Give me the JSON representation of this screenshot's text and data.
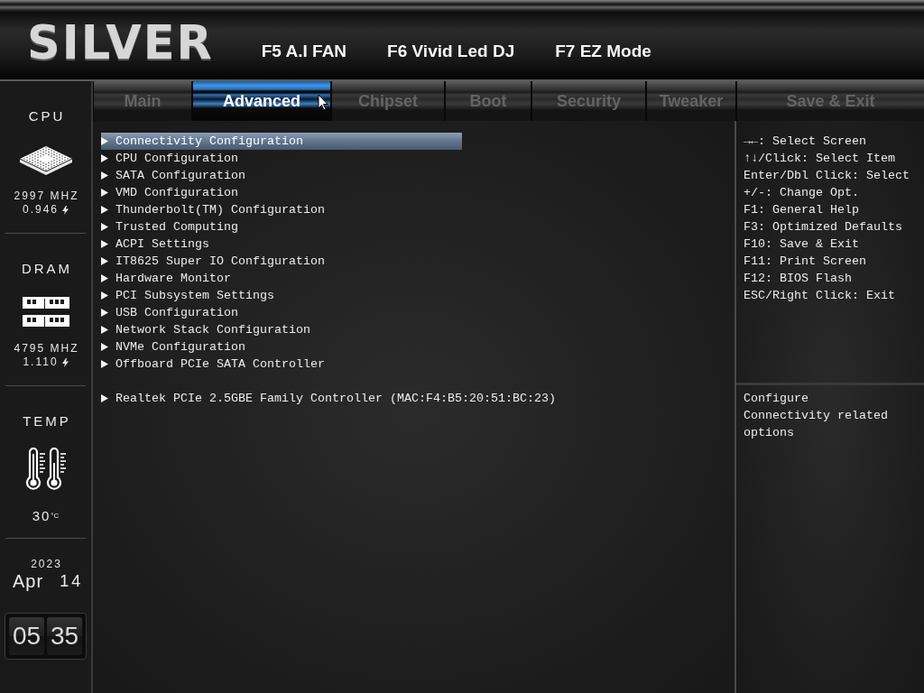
{
  "header": {
    "logo": "SILVER",
    "hotkeys": [
      "F5 A.I FAN",
      "F6 Vivid Led DJ",
      "F7 EZ Mode"
    ]
  },
  "sidebar": {
    "monitors": [
      {
        "kind": "cpu",
        "label": "CPU",
        "frequency": "2997 MHZ",
        "voltage": "0.946"
      },
      {
        "kind": "dram",
        "label": "DRAM",
        "frequency": "4795 MHZ",
        "voltage": "1.110"
      },
      {
        "kind": "temp",
        "label": "TEMP",
        "value": "30",
        "unit": "°C"
      }
    ],
    "date": {
      "year": "2023",
      "month": "Apr",
      "day": "14"
    },
    "clock": {
      "hours": "05",
      "minutes": "35"
    }
  },
  "tabs": [
    {
      "label": "Main",
      "selected": false
    },
    {
      "label": "Advanced",
      "selected": true
    },
    {
      "label": "Chipset",
      "selected": false
    },
    {
      "label": "Boot",
      "selected": false
    },
    {
      "label": "Security",
      "selected": false
    },
    {
      "label": "Tweaker",
      "selected": false
    },
    {
      "label": "Save & Exit",
      "selected": false
    }
  ],
  "menu_sections": [
    {
      "items": [
        {
          "label": "Connectivity Configuration",
          "selected": true
        },
        {
          "label": "CPU Configuration",
          "selected": false
        },
        {
          "label": "SATA Configuration",
          "selected": false
        },
        {
          "label": "VMD Configuration",
          "selected": false
        },
        {
          "label": "Thunderbolt(TM) Configuration",
          "selected": false
        },
        {
          "label": "Trusted Computing",
          "selected": false
        },
        {
          "label": "ACPI Settings",
          "selected": false
        },
        {
          "label": "IT8625 Super IO Configuration",
          "selected": false
        },
        {
          "label": "Hardware Monitor",
          "selected": false
        },
        {
          "label": "PCI Subsystem Settings",
          "selected": false
        },
        {
          "label": "USB Configuration",
          "selected": false
        },
        {
          "label": "Network Stack Configuration",
          "selected": false
        },
        {
          "label": "NVMe Configuration",
          "selected": false
        },
        {
          "label": "Offboard PCIe SATA Controller",
          "selected": false
        }
      ]
    },
    {
      "items": [
        {
          "label": "Realtek PCIe 2.5GBE Family Controller (MAC:F4:B5:20:51:BC:23)",
          "selected": false
        }
      ]
    }
  ],
  "help": {
    "keys": [
      "→←: Select Screen",
      "↑↓/Click: Select Item",
      "Enter/Dbl Click: Select",
      "+/-: Change Opt.",
      "F1: General Help",
      "F3: Optimized Defaults",
      "F10: Save & Exit",
      "F11: Print Screen",
      "F12: BIOS Flash",
      "ESC/Right Click: Exit"
    ],
    "description": "Configure Connectivity related options"
  }
}
